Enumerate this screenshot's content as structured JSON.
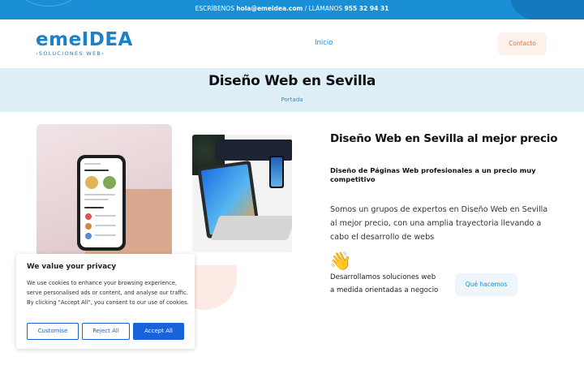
{
  "topbar": {
    "prefix": "ESCRÍBENOS ",
    "email": "hola@emeidea.com",
    "separator": " / LLÁMANOS ",
    "phone": "955 32 94 31"
  },
  "header": {
    "logo_main": "emeIDEA",
    "logo_sub": "‹SOLUCIONES WEB›",
    "nav_home": "Inicio",
    "contact_button": "Contacto"
  },
  "hero": {
    "title": "Diseño Web en Sevilla",
    "breadcrumb": "Portada"
  },
  "content": {
    "title": "Diseño Web en Sevilla al mejor precio",
    "subtitle": "Diseño de Páginas Web profesionales a un precio muy competitivo",
    "paragraph": "Somos un grupos de expertos en Diseño Web en Sevilla al mejor precio, con una amplia trayectoria llevando a cabo el desarrollo de webs",
    "wave_icon": "👋",
    "line1": "Desarrollamos soluciones web",
    "line2": "a medida orientadas a negocio",
    "que_button": "Qué hacemos"
  },
  "cookie": {
    "title": "We value your privacy",
    "text": "We use cookies to enhance your browsing experience, serve personalised ads or content, and analyse our traffic. By clicking \"Accept All\", you consent to our use of cookies.",
    "customise": "Customise",
    "reject": "Reject All",
    "accept": "Accept All"
  },
  "colors": {
    "accent_blue": "#1c8fd0",
    "topbar_blue": "#1a8fd6",
    "hero_bg": "#dfeff8",
    "contact_orange": "#d9773a",
    "cookie_blue": "#1863dc"
  }
}
